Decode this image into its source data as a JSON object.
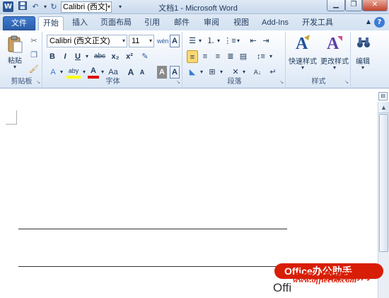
{
  "titlebar": {
    "app_icon": "W",
    "save_icon": "save-icon",
    "undo_icon": "undo-icon",
    "redo_icon": "redo-icon",
    "qat_font": "Calibri (西文]",
    "title": "文档1 - Microsoft Word",
    "minimize": "▁",
    "restore": "❐",
    "close": "✕"
  },
  "tabs": [
    {
      "label": "文件"
    },
    {
      "label": "开始"
    },
    {
      "label": "插入"
    },
    {
      "label": "页面布局"
    },
    {
      "label": "引用"
    },
    {
      "label": "邮件"
    },
    {
      "label": "审阅"
    },
    {
      "label": "视图"
    },
    {
      "label": "Add-Ins"
    },
    {
      "label": "开发工具"
    }
  ],
  "ribbon": {
    "clipboard": {
      "label": "剪贴板",
      "paste": "粘贴"
    },
    "font": {
      "label": "字体",
      "font_name": "Calibri (西文正文)",
      "font_size": "11",
      "bold": "B",
      "italic": "I",
      "underline": "U",
      "strike": "abc",
      "subscript": "x₂",
      "superscript": "x²",
      "wen": "wén",
      "grow": "A",
      "shrink": "A",
      "change_case": "Aa",
      "clear": "A",
      "char_border": "A",
      "char_shade": "A",
      "highlight": "aby",
      "font_color": "A"
    },
    "paragraph": {
      "label": "段落"
    },
    "styles": {
      "label": "样式",
      "quick": "快速样式",
      "change": "更改样式"
    },
    "editing": {
      "label": "编辑"
    }
  },
  "watermark": {
    "pill": "Office办公助手",
    "cn": "Office教程学习网",
    "url": "www.office68.com",
    "text": "Offi"
  },
  "colors": {
    "accent": "#2b5797",
    "file_tab": "#2a5ea8",
    "highlight": "#ffff00",
    "font_color": "#e00000",
    "watermark": "#d81e06"
  }
}
